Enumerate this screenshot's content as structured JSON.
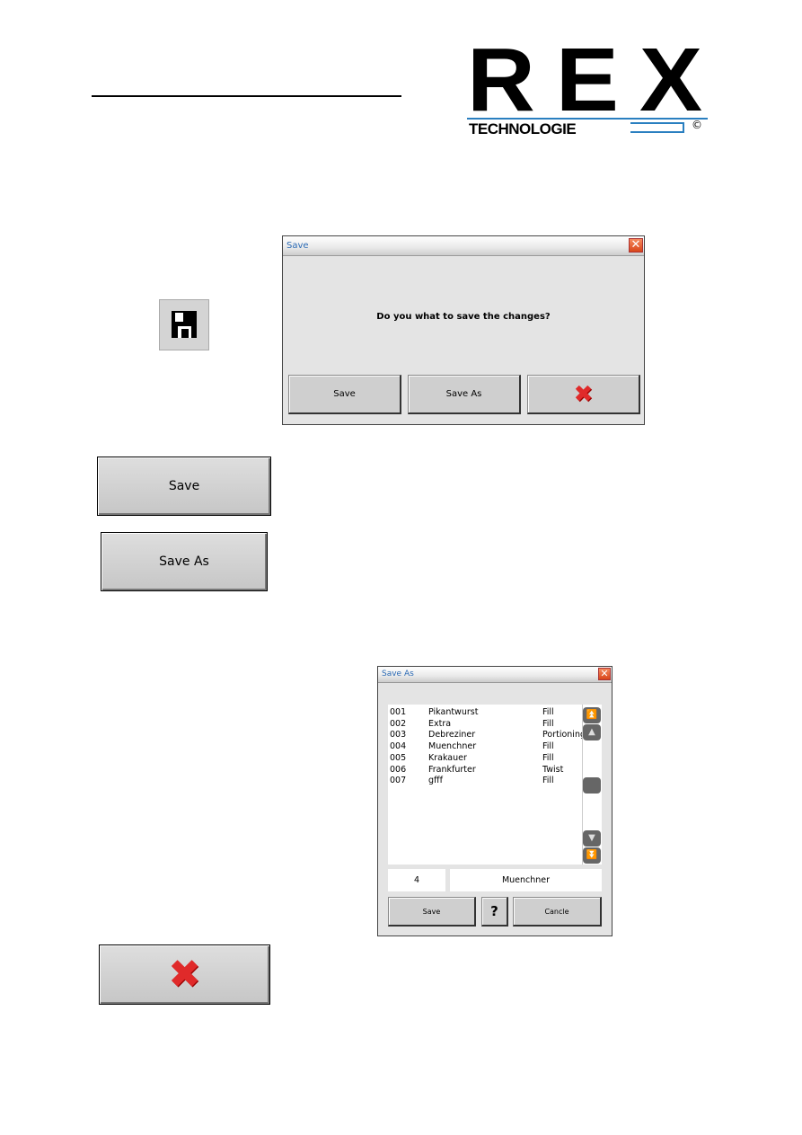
{
  "logo": {
    "name": "REX",
    "subtitle": "TECHNOLOGIE",
    "mark": "©"
  },
  "icons": {
    "save": "floppy-disk-icon",
    "cancel": "red-x-icon"
  },
  "save_dialog": {
    "title": "Save",
    "message": "Do you what to save the changes?",
    "save": "Save",
    "save_as": "Save As",
    "close": "✕",
    "cancel": "✖"
  },
  "buttons": {
    "save": "Save",
    "save_as": "Save As",
    "cancel": "✖"
  },
  "save_as_dialog": {
    "title": "Save As",
    "close": "✕",
    "rows": [
      [
        "001",
        "Pikantwurst",
        "Fill"
      ],
      [
        "002",
        "Extra",
        "Fill"
      ],
      [
        "003",
        "Debreziner",
        "Portioning"
      ],
      [
        "004",
        "Muenchner",
        "Fill"
      ],
      [
        "005",
        "Krakauer",
        "Fill"
      ],
      [
        "006",
        "Frankfurter",
        "Twist"
      ],
      [
        "007",
        "gfff",
        "Fill"
      ]
    ],
    "number": "4",
    "name": "Muenchner",
    "save": "Save",
    "help": "?",
    "cancel": "Cancle",
    "scroll": {
      "top": "⏫",
      "up": "▲",
      "down": "▼",
      "bottom": "⏬"
    }
  }
}
